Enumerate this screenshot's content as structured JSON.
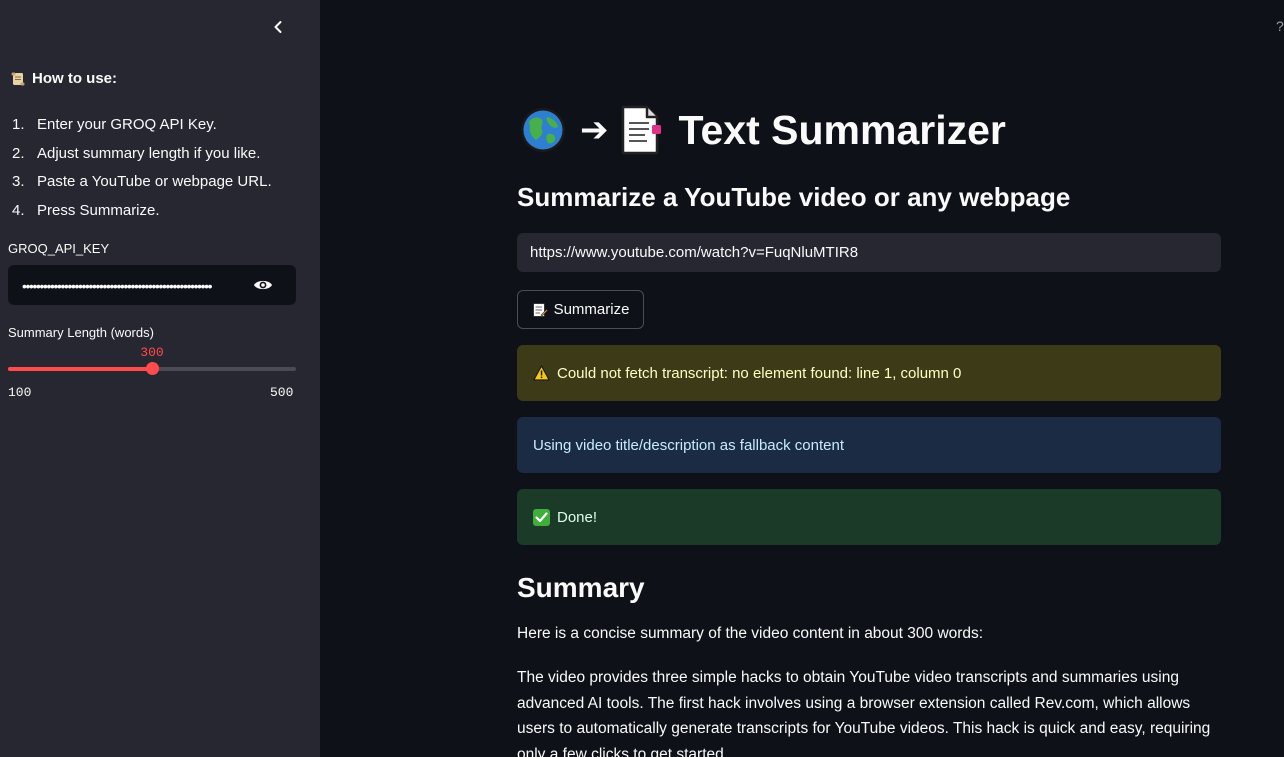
{
  "sidebar": {
    "howto_title": "How to use:",
    "steps": [
      {
        "num": "1.",
        "text": "Enter your GROQ API Key."
      },
      {
        "num": "2.",
        "text": "Adjust summary length if you like."
      },
      {
        "num": "3.",
        "text": "Paste a YouTube or webpage URL."
      },
      {
        "num": "4.",
        "text": "Press Summarize."
      }
    ],
    "api_key_label": "GROQ_API_KEY",
    "api_key_value": "••••••••••••••••••••••••••••••••••••••••••••••••••••••",
    "slider": {
      "label": "Summary Length (words)",
      "value": 300,
      "value_text": "300",
      "min": 100,
      "max": 500,
      "min_text": "100",
      "max_text": "500"
    }
  },
  "main": {
    "help_glyph": "?",
    "title_arrow": "➔",
    "title": "Text Summarizer",
    "subtitle": "Summarize a YouTube video or any webpage",
    "url_value": "https://www.youtube.com/watch?v=FuqNluMTIR8",
    "summarize_label": "Summarize",
    "warning_text": "Could not fetch transcript: no element found: line 1, column 0",
    "info_text": "Using video title/description as fallback content",
    "success_text": "Done!",
    "summary_heading": "Summary",
    "summary_intro": "Here is a concise summary of the video content in about 300 words:",
    "summary_body": "The video provides three simple hacks to obtain YouTube video transcripts and summaries using advanced AI tools. The first hack involves using a browser extension called Rev.com, which allows users to automatically generate transcripts for YouTube videos. This hack is quick and easy, requiring only a few clicks to get started."
  },
  "colors": {
    "background": "#0e1117",
    "sidebar": "#262730",
    "accent": "#ff4b4b",
    "warning_bg": "#3d3a17",
    "info_bg": "#1b2b44",
    "success_bg": "#1b3a28"
  },
  "icons": [
    "chevron-left-icon",
    "scroll-icon",
    "eye-icon",
    "globe-icon",
    "arrow-right-icon",
    "page-icon",
    "memo-icon",
    "warning-icon",
    "check-icon",
    "help-icon"
  ]
}
